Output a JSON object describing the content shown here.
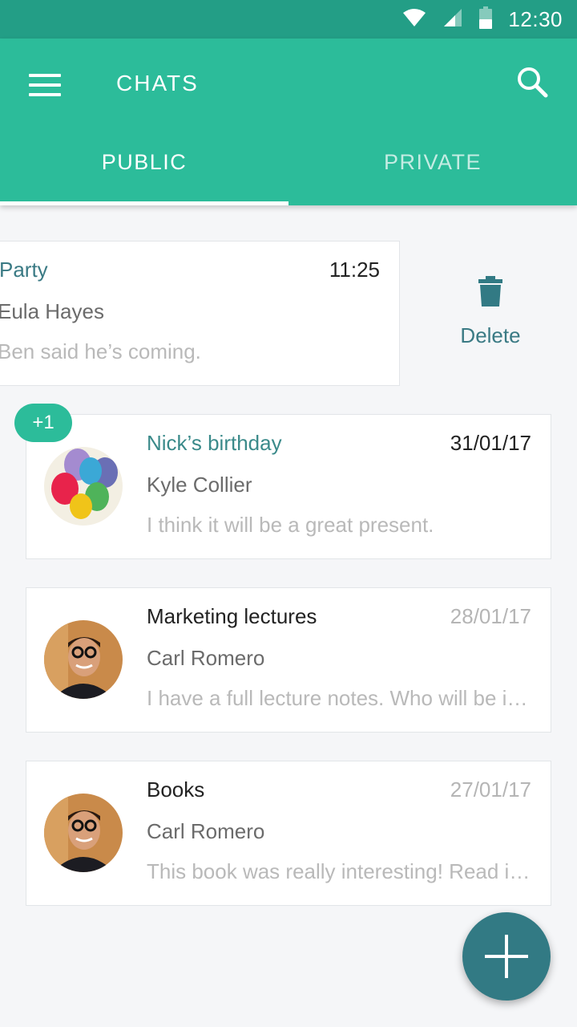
{
  "status": {
    "time": "12:30"
  },
  "appbar": {
    "title": "CHATS"
  },
  "tabs": [
    {
      "label": "PUBLIC",
      "active": true
    },
    {
      "label": "PRIVATE",
      "active": false
    }
  ],
  "swiped_chat": {
    "subject": "Party",
    "date": "11:25",
    "sender": "Eula Hayes",
    "preview": "Ben said he’s coming.",
    "delete_label": "Delete"
  },
  "chats": [
    {
      "subject": "Nick’s birthday",
      "date": "31/01/17",
      "sender": "Kyle Collier",
      "preview": "I think it will be a great present.",
      "badge": "+1",
      "avatar": "balloons-image"
    },
    {
      "subject": "Marketing lectures",
      "date": "28/01/17",
      "sender": "Carl Romero",
      "preview": "I have a full lecture notes. Who will be interested?",
      "avatar": "man-glasses-photo"
    },
    {
      "subject": "Books",
      "date": "27/01/17",
      "sender": "Carl Romero",
      "preview": "This book was really interesting! Read it as soon as possible",
      "avatar": "man-glasses-photo"
    }
  ],
  "colors": {
    "primary": "#2cbc9a",
    "primary_dark": "#239e86",
    "accent": "#327a84"
  },
  "icons": [
    "wifi-icon",
    "signal-icon",
    "battery-icon",
    "menu-icon",
    "search-icon",
    "trash-icon",
    "plus-icon"
  ]
}
